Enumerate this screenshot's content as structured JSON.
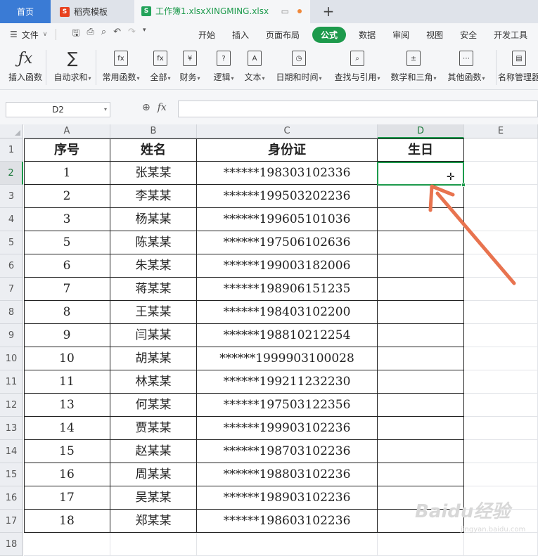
{
  "tabs": {
    "home": "首页",
    "templates": "稻壳模板",
    "file": "工作簿1.xlsxXINGMING.xlsx",
    "new_tab": "+"
  },
  "menu": {
    "file": "文件",
    "items": [
      "开始",
      "插入",
      "页面布局",
      "公式",
      "数据",
      "审阅",
      "视图",
      "安全",
      "开发工具"
    ],
    "active": "公式"
  },
  "ribbon": {
    "buttons": [
      {
        "label": "插入函数",
        "icon": "fx-icon"
      },
      {
        "label": "自动求和",
        "icon": "sigma-icon"
      },
      {
        "label": "常用函数",
        "icon": "common-functions-icon"
      },
      {
        "label": "全部",
        "icon": "all-functions-icon"
      },
      {
        "label": "财务",
        "icon": "finance-icon"
      },
      {
        "label": "逻辑",
        "icon": "logic-icon"
      },
      {
        "label": "文本",
        "icon": "text-icon"
      },
      {
        "label": "日期和时间",
        "icon": "datetime-icon"
      },
      {
        "label": "查找与引用",
        "icon": "lookup-icon"
      },
      {
        "label": "数学和三角",
        "icon": "math-icon"
      },
      {
        "label": "其他函数",
        "icon": "other-functions-icon"
      },
      {
        "label": "名称管理器",
        "icon": "name-manager-icon"
      }
    ]
  },
  "formula_bar": {
    "name_box": "D2",
    "formula": ""
  },
  "sheet": {
    "columns": [
      "A",
      "B",
      "C",
      "D",
      "E"
    ],
    "selected_column": "D",
    "selected_row": "2",
    "row_numbers": [
      "1",
      "2",
      "3",
      "4",
      "5",
      "6",
      "7",
      "8",
      "9",
      "10",
      "11",
      "12",
      "13",
      "14",
      "15",
      "16",
      "17",
      "18"
    ],
    "header": [
      "序号",
      "姓名",
      "身份证",
      "生日"
    ],
    "rows": [
      [
        "1",
        "张某某",
        "******198303102336",
        ""
      ],
      [
        "2",
        "李某某",
        "******199503202236",
        ""
      ],
      [
        "3",
        "杨某某",
        "******199605101036",
        ""
      ],
      [
        "5",
        "陈某某",
        "******197506102636",
        ""
      ],
      [
        "6",
        "朱某某",
        "******199003182006",
        ""
      ],
      [
        "7",
        "蒋某某",
        "******198906151235",
        ""
      ],
      [
        "8",
        "王某某",
        "******198403102200",
        ""
      ],
      [
        "9",
        "闫某某",
        "******198810212254",
        ""
      ],
      [
        "10",
        "胡某某",
        "******1999903100028",
        ""
      ],
      [
        "11",
        "林某某",
        "******199211232230",
        ""
      ],
      [
        "13",
        "何某某",
        "******197503122356",
        ""
      ],
      [
        "14",
        "贾某某",
        "******199903102236",
        ""
      ],
      [
        "15",
        "赵某某",
        "******198703102236",
        ""
      ],
      [
        "16",
        "周某某",
        "******198803102236",
        ""
      ],
      [
        "17",
        "吴某某",
        "******198903102236",
        ""
      ],
      [
        "18",
        "郑某某",
        "******198603102236",
        ""
      ]
    ]
  },
  "watermark": {
    "logo": "Baidu经验",
    "url": "jingyan.baidu.com"
  },
  "colors": {
    "accent_green": "#1d9a4c",
    "tab_blue": "#3a7bd5",
    "arrow": "#e8734f"
  }
}
